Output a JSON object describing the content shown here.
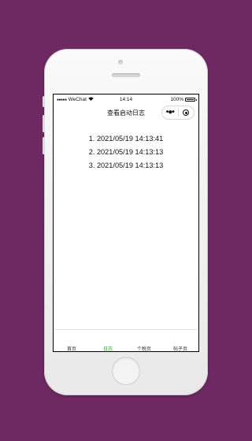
{
  "status_bar": {
    "signal": "●●●●●",
    "carrier": "WeChat",
    "wifi_icon": "wifi-icon",
    "time": "14:14",
    "battery_text": "100%",
    "battery_level": 1.0
  },
  "nav": {
    "title": "查看启动日志",
    "more_icon": "more-dots-icon",
    "close_icon": "target-close-icon"
  },
  "logs": [
    "1. 2021/05/19 14:13:41",
    "2. 2021/05/19 14:13:13",
    "3. 2021/05/19 14:13:13"
  ],
  "tabs": [
    {
      "label": "首页",
      "active": false
    },
    {
      "label": "日志",
      "active": true
    },
    {
      "label": "个税页",
      "active": false
    },
    {
      "label": "帖子页",
      "active": false
    }
  ],
  "colors": {
    "background": "#6e2862",
    "active_tab": "#1aad19"
  }
}
